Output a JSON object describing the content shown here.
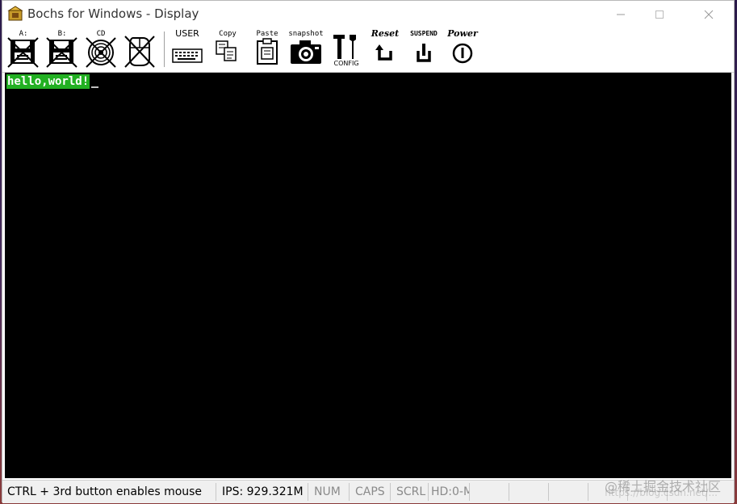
{
  "window": {
    "title": "Bochs for Windows - Display",
    "app_icon": "bochs-icon",
    "controls": {
      "minimize_icon": "minimize-icon",
      "maximize_icon": "maximize-icon",
      "close_icon": "close-icon"
    }
  },
  "toolbar": {
    "items": [
      {
        "id": "floppy-a",
        "label": "A:",
        "icon": "floppy-disabled-icon"
      },
      {
        "id": "floppy-b",
        "label": "B:",
        "icon": "floppy-disabled-icon"
      },
      {
        "id": "cdrom",
        "label": "CD",
        "icon": "cdrom-disabled-icon"
      },
      {
        "id": "mouse",
        "label": "",
        "icon": "mouse-disabled-icon"
      },
      {
        "id": "user",
        "label": "USER",
        "icon": "keyboard-icon"
      },
      {
        "id": "copy",
        "label": "Copy",
        "icon": "copy-icon"
      },
      {
        "id": "paste",
        "label": "Paste",
        "icon": "paste-icon"
      },
      {
        "id": "snapshot",
        "label": "snapshot",
        "icon": "camera-icon"
      },
      {
        "id": "config",
        "label": "CONFIG",
        "icon": "config-icon"
      },
      {
        "id": "reset",
        "label": "Reset",
        "icon": "reset-icon"
      },
      {
        "id": "suspend",
        "label": "SUSPEND",
        "icon": "suspend-icon"
      },
      {
        "id": "power",
        "label": "Power",
        "icon": "power-icon"
      }
    ]
  },
  "screen": {
    "text": "hello,world!",
    "text_bg": "#22b022",
    "text_color": "#ffffff",
    "bg": "#000000"
  },
  "statusbar": {
    "mouse_hint": "CTRL + 3rd button enables mouse",
    "ips": "IPS: 929.321M",
    "num": "NUM",
    "caps": "CAPS",
    "scrl": "SCRL",
    "hd": "HD:0-M"
  },
  "watermark": {
    "text": "@稀土掘金技术社区",
    "url": "https://blog.csdn.net/..."
  }
}
